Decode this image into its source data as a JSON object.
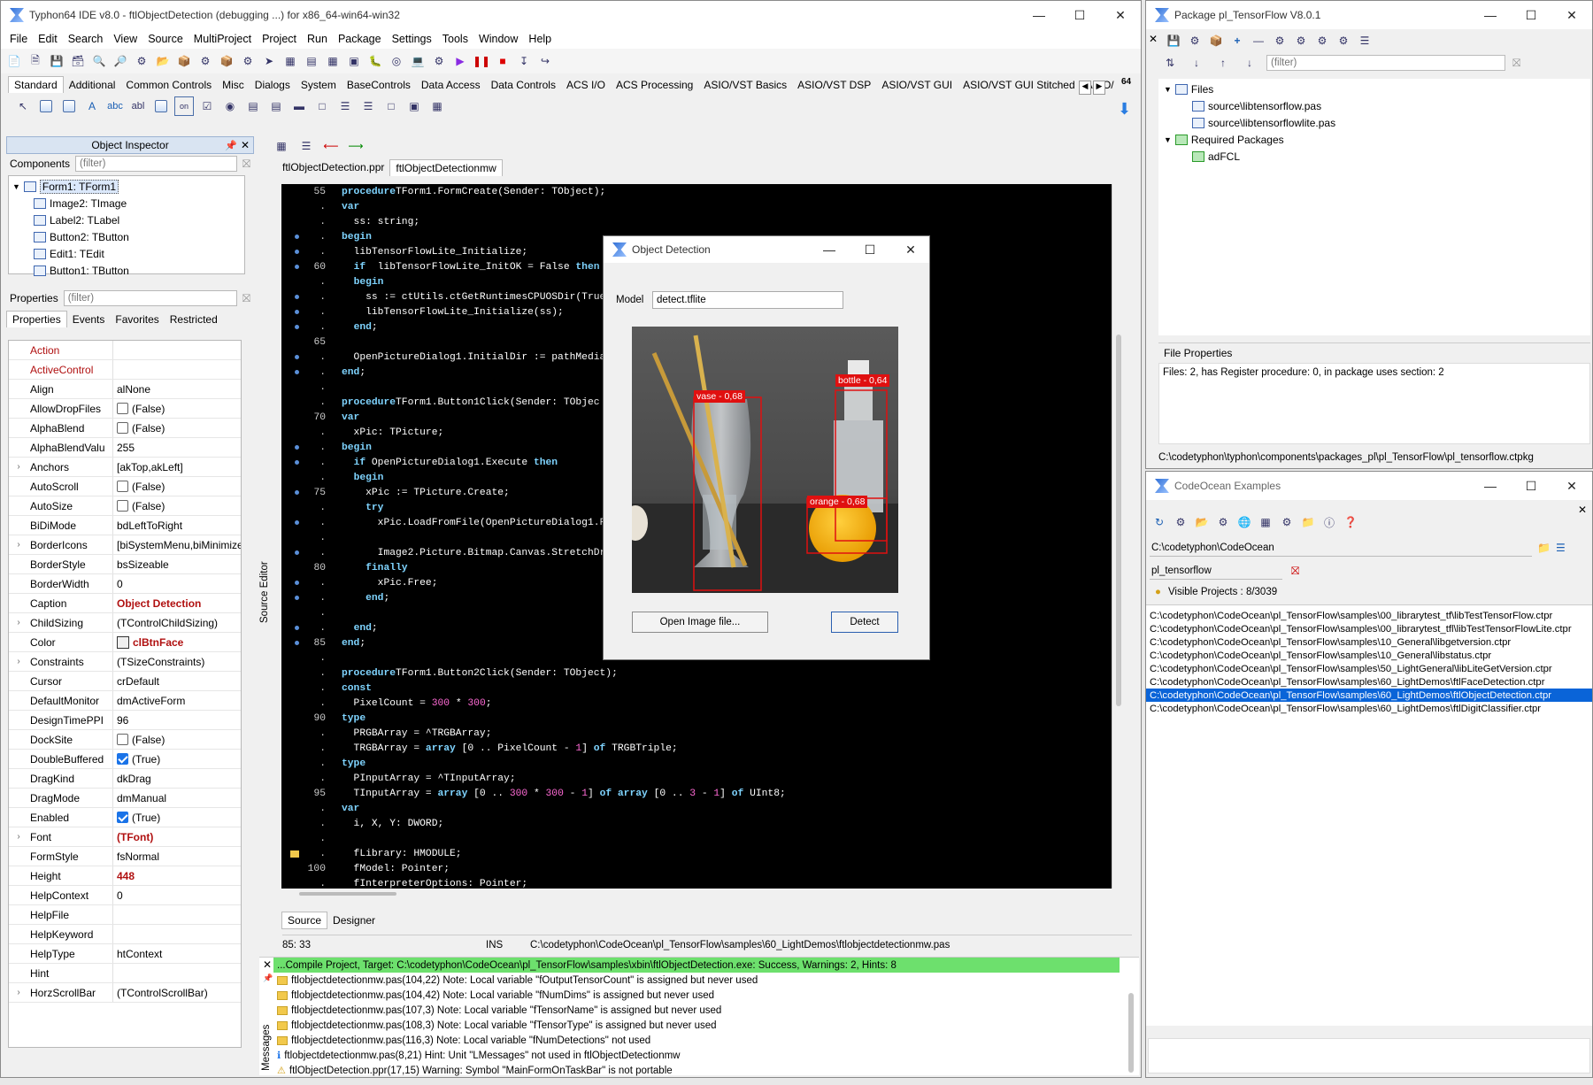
{
  "ide": {
    "title": "Typhon64 IDE v8.0 - ftlObjectDetection (debugging ...) for x86_64-win64-win32",
    "menu": [
      "File",
      "Edit",
      "Search",
      "View",
      "Source",
      "MultiProject",
      "Project",
      "Run",
      "Package",
      "Settings",
      "Tools",
      "Window",
      "Help"
    ],
    "palette_tabs": [
      "Standard",
      "Additional",
      "Common Controls",
      "Misc",
      "Dialogs",
      "System",
      "BaseControls",
      "Data Access",
      "Data Controls",
      "ACS I/O",
      "ACS Processing",
      "ASIO/VST Basics",
      "ASIO/VST DSP",
      "ASIO/VST GUI",
      "ASIO/VST GUI Stitched",
      "ASIO/"
    ],
    "bits_label": "64"
  },
  "inspector": {
    "header": "Object Inspector",
    "components_label": "Components",
    "components_filter": "(filter)",
    "tree": [
      "Form1: TForm1",
      "Image2: TImage",
      "Label2: TLabel",
      "Button2: TButton",
      "Edit1: TEdit",
      "Button1: TButton"
    ],
    "properties_label": "Properties",
    "properties_filter": "(filter)",
    "tabs": [
      "Properties",
      "Events",
      "Favorites",
      "Restricted"
    ],
    "props": [
      {
        "n": "Action",
        "v": "",
        "red": true
      },
      {
        "n": "ActiveControl",
        "v": "",
        "red": true
      },
      {
        "n": "Align",
        "v": "alNone"
      },
      {
        "n": "AllowDropFiles",
        "v": "(False)",
        "cb": "off"
      },
      {
        "n": "AlphaBlend",
        "v": "(False)",
        "cb": "off"
      },
      {
        "n": "AlphaBlendValu",
        "v": "255"
      },
      {
        "n": "Anchors",
        "v": "[akTop,akLeft]",
        "exp": true
      },
      {
        "n": "AutoScroll",
        "v": "(False)",
        "cb": "off"
      },
      {
        "n": "AutoSize",
        "v": "(False)",
        "cb": "off"
      },
      {
        "n": "BiDiMode",
        "v": "bdLeftToRight"
      },
      {
        "n": "BorderIcons",
        "v": "[biSystemMenu,biMinimize",
        "exp": true
      },
      {
        "n": "BorderStyle",
        "v": "bsSizeable"
      },
      {
        "n": "BorderWidth",
        "v": "0"
      },
      {
        "n": "Caption",
        "v": "Object Detection",
        "vred": true
      },
      {
        "n": "ChildSizing",
        "v": "(TControlChildSizing)",
        "exp": true
      },
      {
        "n": "Color",
        "v": "clBtnFace",
        "vred": true,
        "swatch": true
      },
      {
        "n": "Constraints",
        "v": "(TSizeConstraints)",
        "exp": true
      },
      {
        "n": "Cursor",
        "v": "crDefault"
      },
      {
        "n": "DefaultMonitor",
        "v": "dmActiveForm"
      },
      {
        "n": "DesignTimePPI",
        "v": "96"
      },
      {
        "n": "DockSite",
        "v": "(False)",
        "cb": "off"
      },
      {
        "n": "DoubleBuffered",
        "v": "(True)",
        "cb": "on"
      },
      {
        "n": "DragKind",
        "v": "dkDrag"
      },
      {
        "n": "DragMode",
        "v": "dmManual"
      },
      {
        "n": "Enabled",
        "v": "(True)",
        "cb": "on"
      },
      {
        "n": "Font",
        "v": "(TFont)",
        "vred": true,
        "exp": true
      },
      {
        "n": "FormStyle",
        "v": "fsNormal"
      },
      {
        "n": "Height",
        "v": "448",
        "vred": true
      },
      {
        "n": "HelpContext",
        "v": "0"
      },
      {
        "n": "HelpFile",
        "v": ""
      },
      {
        "n": "HelpKeyword",
        "v": ""
      },
      {
        "n": "HelpType",
        "v": "htContext"
      },
      {
        "n": "Hint",
        "v": ""
      },
      {
        "n": "HorzScrollBar",
        "v": "(TControlScrollBar)",
        "exp": true
      }
    ]
  },
  "editor": {
    "tabs": [
      "ftlObjectDetection.ppr",
      "ftlObjectDetectionmw"
    ],
    "side_label": "Source Editor",
    "bottom_tabs": [
      "Source",
      "Designer"
    ],
    "status": {
      "pos": "85: 33",
      "mode": "INS",
      "path": "C:\\codetyphon\\CodeOcean\\pl_TensorFlow\\samples\\60_LightDemos\\ftlobjectdetectionmw.pas"
    },
    "lines": [
      {
        "no": "55",
        "dot": false,
        "t": [
          [
            "kw",
            "procedure"
          ],
          [
            "",
            "TForm1.FormCreate(Sender: TObject);"
          ]
        ]
      },
      {
        "no": ".",
        "dot": false,
        "t": [
          [
            "kw",
            "var"
          ]
        ]
      },
      {
        "no": ".",
        "dot": false,
        "t": [
          [
            "",
            "  ss: string;"
          ]
        ]
      },
      {
        "no": ".",
        "dot": true,
        "t": [
          [
            "kw",
            "begin"
          ]
        ]
      },
      {
        "no": ".",
        "dot": true,
        "t": [
          [
            "",
            "  libTensorFlowLite_Initialize;"
          ]
        ]
      },
      {
        "no": "60",
        "dot": true,
        "t": [
          [
            "",
            "  "
          ],
          [
            "kw",
            "if"
          ],
          [
            "",
            "  libTensorFlowLite_InitOK = False "
          ],
          [
            "kw",
            "then"
          ]
        ]
      },
      {
        "no": ".",
        "dot": false,
        "t": [
          [
            "",
            "  "
          ],
          [
            "kw",
            "begin"
          ]
        ]
      },
      {
        "no": ".",
        "dot": true,
        "t": [
          [
            "",
            "    ss := ctUtils.ctGetRuntimesCPUOSDir(True"
          ]
        ]
      },
      {
        "no": ".",
        "dot": true,
        "t": [
          [
            "",
            "    libTensorFlowLite_Initialize(ss);"
          ]
        ]
      },
      {
        "no": ".",
        "dot": true,
        "t": [
          [
            "",
            "  "
          ],
          [
            "kw",
            "end"
          ],
          [
            "",
            ";"
          ]
        ]
      },
      {
        "no": "65",
        "dot": false,
        "t": [
          [
            "",
            ""
          ]
        ]
      },
      {
        "no": ".",
        "dot": true,
        "t": [
          [
            "",
            "  OpenPictureDialog1.InitialDir := pathMedia"
          ]
        ]
      },
      {
        "no": ".",
        "dot": true,
        "t": [
          [
            "kw",
            "end"
          ],
          [
            "",
            ";"
          ]
        ]
      },
      {
        "no": ".",
        "dot": false,
        "t": [
          [
            "",
            ""
          ]
        ]
      },
      {
        "no": ".",
        "dot": false,
        "t": [
          [
            "kw",
            "procedure"
          ],
          [
            "",
            "TForm1.Button1Click(Sender: TObjec"
          ]
        ]
      },
      {
        "no": "70",
        "dot": false,
        "t": [
          [
            "kw",
            "var"
          ]
        ]
      },
      {
        "no": ".",
        "dot": false,
        "t": [
          [
            "",
            "  xPic: TPicture;"
          ]
        ]
      },
      {
        "no": ".",
        "dot": true,
        "t": [
          [
            "kw",
            "begin"
          ]
        ]
      },
      {
        "no": ".",
        "dot": true,
        "t": [
          [
            "",
            "  "
          ],
          [
            "kw",
            "if"
          ],
          [
            "",
            " OpenPictureDialog1.Execute "
          ],
          [
            "kw",
            "then"
          ]
        ]
      },
      {
        "no": ".",
        "dot": false,
        "t": [
          [
            "",
            "  "
          ],
          [
            "kw",
            "begin"
          ]
        ]
      },
      {
        "no": "75",
        "dot": true,
        "t": [
          [
            "",
            "    xPic := TPicture.Create;"
          ]
        ]
      },
      {
        "no": ".",
        "dot": false,
        "t": [
          [
            "",
            "    "
          ],
          [
            "kw",
            "try"
          ]
        ]
      },
      {
        "no": ".",
        "dot": true,
        "t": [
          [
            "",
            "      xPic.LoadFromFile(OpenPictureDialog1.F"
          ]
        ]
      },
      {
        "no": ".",
        "dot": false,
        "t": [
          [
            "",
            ""
          ]
        ]
      },
      {
        "no": ".",
        "dot": true,
        "t": [
          [
            "",
            "      Image2.Picture.Bitmap.Canvas.StretchDr"
          ],
          [
            "",
            "                                   );"
          ]
        ]
      },
      {
        "no": "80",
        "dot": false,
        "t": [
          [
            "",
            "    "
          ],
          [
            "kw",
            "finally"
          ]
        ]
      },
      {
        "no": ".",
        "dot": true,
        "t": [
          [
            "",
            "      xPic.Free;"
          ]
        ]
      },
      {
        "no": ".",
        "dot": true,
        "t": [
          [
            "",
            "    "
          ],
          [
            "kw",
            "end"
          ],
          [
            "",
            ";"
          ]
        ]
      },
      {
        "no": ".",
        "dot": false,
        "t": [
          [
            "",
            ""
          ]
        ]
      },
      {
        "no": ".",
        "dot": true,
        "t": [
          [
            "",
            "  "
          ],
          [
            "kw",
            "end"
          ],
          [
            "",
            ";"
          ]
        ]
      },
      {
        "no": "85",
        "dot": true,
        "t": [
          [
            "kw",
            "end"
          ],
          [
            "",
            ";"
          ]
        ]
      },
      {
        "no": ".",
        "dot": false,
        "t": [
          [
            "",
            ""
          ]
        ]
      },
      {
        "no": ".",
        "dot": false,
        "t": [
          [
            "kw",
            "procedure"
          ],
          [
            "",
            "TForm1.Button2Click(Sender: TObject);"
          ]
        ]
      },
      {
        "no": ".",
        "dot": false,
        "t": [
          [
            "kw",
            "const"
          ]
        ]
      },
      {
        "no": ".",
        "dot": false,
        "t": [
          [
            "",
            "  PixelCount = "
          ],
          [
            "num",
            "300"
          ],
          [
            "",
            " * "
          ],
          [
            "num",
            "300"
          ],
          [
            "",
            ";"
          ]
        ]
      },
      {
        "no": "90",
        "dot": false,
        "t": [
          [
            "kw",
            "type"
          ]
        ]
      },
      {
        "no": ".",
        "dot": false,
        "t": [
          [
            "",
            "  PRGBArray = ^TRGBArray;"
          ]
        ]
      },
      {
        "no": ".",
        "dot": false,
        "t": [
          [
            "",
            "  TRGBArray = "
          ],
          [
            "kw",
            "array"
          ],
          [
            "",
            " [0 .. PixelCount - "
          ],
          [
            "num",
            "1"
          ],
          [
            "",
            "] "
          ],
          [
            "kw",
            "of"
          ],
          [
            "",
            " TRGBTriple;"
          ]
        ]
      },
      {
        "no": ".",
        "dot": false,
        "t": [
          [
            "kw",
            "type"
          ]
        ]
      },
      {
        "no": ".",
        "dot": false,
        "t": [
          [
            "",
            "  PInputArray = ^TInputArray;"
          ]
        ]
      },
      {
        "no": "95",
        "dot": false,
        "t": [
          [
            "",
            "  TInputArray = "
          ],
          [
            "kw",
            "array"
          ],
          [
            "",
            " [0 .. "
          ],
          [
            "num",
            "300"
          ],
          [
            "",
            " * "
          ],
          [
            "num",
            "300"
          ],
          [
            "",
            " - "
          ],
          [
            "num",
            "1"
          ],
          [
            "",
            "] "
          ],
          [
            "kw",
            "of array"
          ],
          [
            "",
            " [0 .. "
          ],
          [
            "num",
            "3"
          ],
          [
            "",
            " - "
          ],
          [
            "num",
            "1"
          ],
          [
            "",
            "] "
          ],
          [
            "kw",
            "of"
          ],
          [
            "",
            " UInt8;"
          ]
        ]
      },
      {
        "no": ".",
        "dot": false,
        "t": [
          [
            "kw",
            "var"
          ]
        ]
      },
      {
        "no": ".",
        "dot": false,
        "t": [
          [
            "",
            "  i, X, Y: DWORD;"
          ]
        ]
      },
      {
        "no": ".",
        "dot": false,
        "t": [
          [
            "",
            ""
          ]
        ]
      },
      {
        "no": ".",
        "dot": false,
        "bm": true,
        "t": [
          [
            "",
            "  fLibrary: HMODULE;"
          ]
        ]
      },
      {
        "no": "100",
        "dot": false,
        "t": [
          [
            "",
            "  fModel: Pointer;"
          ]
        ]
      },
      {
        "no": ".",
        "dot": false,
        "t": [
          [
            "",
            "  fInterpreterOptions: Pointer;"
          ]
        ]
      }
    ]
  },
  "messages": {
    "side_label": "Messages",
    "success": "...Compile Project, Target: C:\\codetyphon\\CodeOcean\\pl_TensorFlow\\samples\\xbin\\ftlObjectDetection.exe: Success, Warnings: 2, Hints: 8",
    "items": [
      "ftlobjectdetectionmw.pas(104,22) Note: Local variable \"fOutputTensorCount\" is assigned but never used",
      "ftlobjectdetectionmw.pas(104,42) Note: Local variable \"fNumDims\" is assigned but never used",
      "ftlobjectdetectionmw.pas(107,3) Note: Local variable \"fTensorName\" is assigned but never used",
      "ftlobjectdetectionmw.pas(108,3) Note: Local variable \"fTensorType\" is assigned but never used",
      "ftlobjectdetectionmw.pas(116,3) Note: Local variable \"fNumDetections\" not used",
      "ftlobjectdetectionmw.pas(8,21) Hint: Unit \"LMessages\" not used in ftlObjectDetectionmw",
      "ftlObjectDetection.ppr(17,15) Warning: Symbol \"MainFormOnTaskBar\" is not portable"
    ]
  },
  "dialog": {
    "title": "Object Detection",
    "model_label": "Model",
    "model_value": "detect.tflite",
    "open_button": "Open Image file...",
    "detect_button": "Detect",
    "detections": [
      {
        "label": "vase - 0,68"
      },
      {
        "label": "bottle - 0,64"
      },
      {
        "label": "orange - 0,68"
      }
    ],
    "colors": {
      "box": "#e01010"
    }
  },
  "package": {
    "title": "Package pl_TensorFlow V8.0.1",
    "filter": "(filter)",
    "files_label": "Files",
    "files": [
      "source\\libtensorflow.pas",
      "source\\libtensorflowlite.pas"
    ],
    "required_label": "Required Packages",
    "required": [
      "adFCL"
    ],
    "props_header": "File Properties",
    "props_text": "Files: 2, has Register procedure: 0, in package uses section: 2",
    "path": "C:\\codetyphon\\typhon\\components\\packages_pl\\pl_TensorFlow\\pl_tensorflow.ctpkg"
  },
  "codeocean": {
    "title": "CodeOcean Examples",
    "dir": "C:\\codetyphon\\CodeOcean",
    "search": "pl_tensorflow",
    "visible": "Visible Projects : 8/3039",
    "projects": [
      "C:\\codetyphon\\CodeOcean\\pl_TensorFlow\\samples\\00_librarytest_tf\\libTestTensorFlow.ctpr",
      "C:\\codetyphon\\CodeOcean\\pl_TensorFlow\\samples\\00_librarytest_tfl\\libTestTensorFlowLite.ctpr",
      "C:\\codetyphon\\CodeOcean\\pl_TensorFlow\\samples\\10_General\\libgetversion.ctpr",
      "C:\\codetyphon\\CodeOcean\\pl_TensorFlow\\samples\\10_General\\libstatus.ctpr",
      "C:\\codetyphon\\CodeOcean\\pl_TensorFlow\\samples\\50_LightGeneral\\libLiteGetVersion.ctpr",
      "C:\\codetyphon\\CodeOcean\\pl_TensorFlow\\samples\\60_LightDemos\\ftlFaceDetection.ctpr",
      "C:\\codetyphon\\CodeOcean\\pl_TensorFlow\\samples\\60_LightDemos\\ftlObjectDetection.ctpr",
      "C:\\codetyphon\\CodeOcean\\pl_TensorFlow\\samples\\60_LightDemos\\ftlDigitClassifier.ctpr"
    ],
    "selected_index": 6
  }
}
